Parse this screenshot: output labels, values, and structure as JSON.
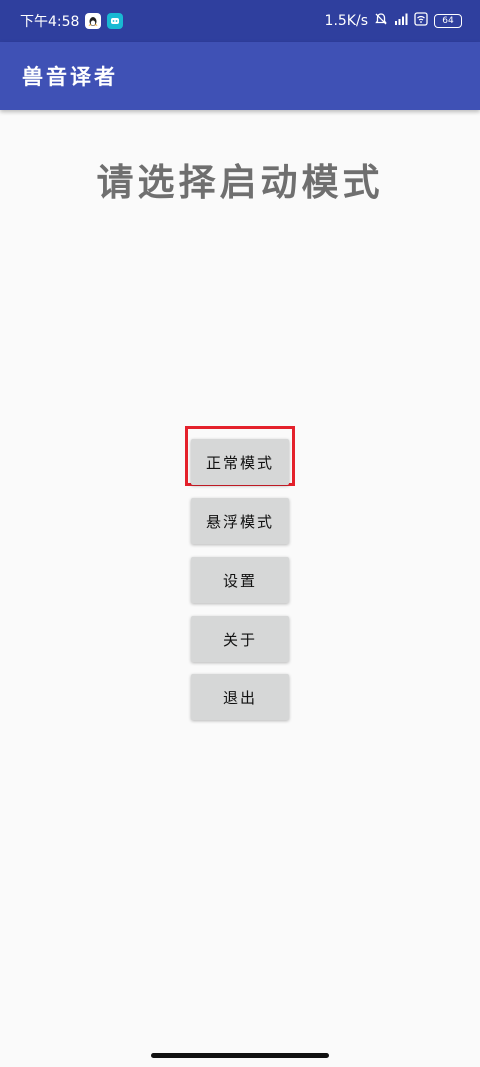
{
  "status_bar": {
    "time": "下午4:58",
    "net_speed": "1.5K/s",
    "battery": "64",
    "icons": [
      "qq-icon",
      "message-app-icon",
      "mute-bell-icon",
      "signal-icon",
      "wifi-icon",
      "battery-icon"
    ]
  },
  "app_bar": {
    "title": "兽音译者"
  },
  "main": {
    "heading": "请选择启动模式",
    "buttons": {
      "normal": "正常模式",
      "floating": "悬浮模式",
      "settings": "设置",
      "about": "关于",
      "exit": "退出"
    }
  },
  "colors": {
    "status_bar": "#2f3f9e",
    "app_bar": "#3f51b5",
    "button": "#d6d7d7",
    "highlight": "#e4212b"
  }
}
